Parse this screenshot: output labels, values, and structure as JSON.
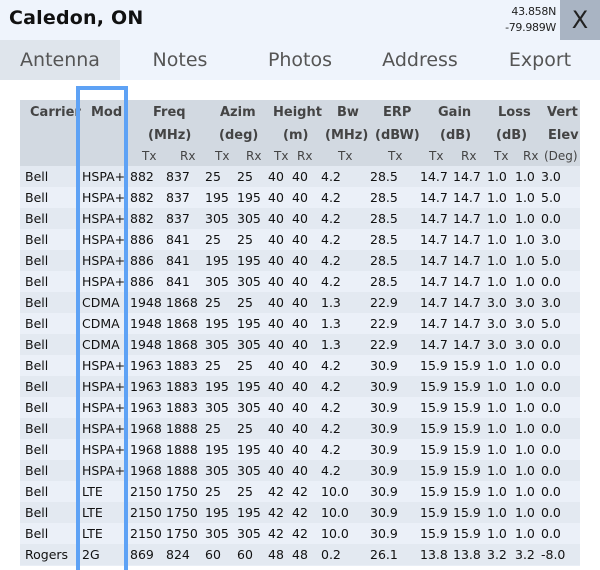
{
  "header": {
    "title": "Caledon, ON",
    "lat": "43.858N",
    "lon": "-79.989W",
    "close_label": "X"
  },
  "tabs": [
    {
      "label": "Antenna",
      "active": true
    },
    {
      "label": "Notes",
      "active": false
    },
    {
      "label": "Photos",
      "active": false
    },
    {
      "label": "Address",
      "active": false
    },
    {
      "label": "Export",
      "active": false
    }
  ],
  "table": {
    "headers": {
      "carrier": "Carrier",
      "mod": "Mod",
      "freq": "Freq",
      "freq_unit": "(MHz)",
      "azim": "Azim",
      "azim_unit": "(deg)",
      "height": "Height",
      "height_unit": "(m)",
      "bw": "Bw",
      "bw_unit": "(MHz)",
      "erp": "ERP",
      "erp_unit": "(dBW)",
      "gain": "Gain",
      "gain_unit": "(dB)",
      "loss": "Loss",
      "loss_unit": "(dB)",
      "vert": "Vert",
      "vert_unit": "Elev",
      "vert_sub": "(Deg)",
      "tx": "Tx",
      "rx": "Rx"
    },
    "highlighted_column": "Mod",
    "highlight_color": "#5ea2f5",
    "rows": [
      [
        "Bell",
        "HSPA+",
        "882",
        "837",
        "25",
        "25",
        "40",
        "40",
        "4.2",
        "28.5",
        "14.7",
        "14.7",
        "1.0",
        "1.0",
        "3.0"
      ],
      [
        "Bell",
        "HSPA+",
        "882",
        "837",
        "195",
        "195",
        "40",
        "40",
        "4.2",
        "28.5",
        "14.7",
        "14.7",
        "1.0",
        "1.0",
        "5.0"
      ],
      [
        "Bell",
        "HSPA+",
        "882",
        "837",
        "305",
        "305",
        "40",
        "40",
        "4.2",
        "28.5",
        "14.7",
        "14.7",
        "1.0",
        "1.0",
        "0.0"
      ],
      [
        "Bell",
        "HSPA+",
        "886",
        "841",
        "25",
        "25",
        "40",
        "40",
        "4.2",
        "28.5",
        "14.7",
        "14.7",
        "1.0",
        "1.0",
        "3.0"
      ],
      [
        "Bell",
        "HSPA+",
        "886",
        "841",
        "195",
        "195",
        "40",
        "40",
        "4.2",
        "28.5",
        "14.7",
        "14.7",
        "1.0",
        "1.0",
        "5.0"
      ],
      [
        "Bell",
        "HSPA+",
        "886",
        "841",
        "305",
        "305",
        "40",
        "40",
        "4.2",
        "28.5",
        "14.7",
        "14.7",
        "1.0",
        "1.0",
        "0.0"
      ],
      [
        "Bell",
        "CDMA",
        "1948",
        "1868",
        "25",
        "25",
        "40",
        "40",
        "1.3",
        "22.9",
        "14.7",
        "14.7",
        "3.0",
        "3.0",
        "3.0"
      ],
      [
        "Bell",
        "CDMA",
        "1948",
        "1868",
        "195",
        "195",
        "40",
        "40",
        "1.3",
        "22.9",
        "14.7",
        "14.7",
        "3.0",
        "3.0",
        "5.0"
      ],
      [
        "Bell",
        "CDMA",
        "1948",
        "1868",
        "305",
        "305",
        "40",
        "40",
        "1.3",
        "22.9",
        "14.7",
        "14.7",
        "3.0",
        "3.0",
        "0.0"
      ],
      [
        "Bell",
        "HSPA+",
        "1963",
        "1883",
        "25",
        "25",
        "40",
        "40",
        "4.2",
        "30.9",
        "15.9",
        "15.9",
        "1.0",
        "1.0",
        "0.0"
      ],
      [
        "Bell",
        "HSPA+",
        "1963",
        "1883",
        "195",
        "195",
        "40",
        "40",
        "4.2",
        "30.9",
        "15.9",
        "15.9",
        "1.0",
        "1.0",
        "0.0"
      ],
      [
        "Bell",
        "HSPA+",
        "1963",
        "1883",
        "305",
        "305",
        "40",
        "40",
        "4.2",
        "30.9",
        "15.9",
        "15.9",
        "1.0",
        "1.0",
        "0.0"
      ],
      [
        "Bell",
        "HSPA+",
        "1968",
        "1888",
        "25",
        "25",
        "40",
        "40",
        "4.2",
        "30.9",
        "15.9",
        "15.9",
        "1.0",
        "1.0",
        "0.0"
      ],
      [
        "Bell",
        "HSPA+",
        "1968",
        "1888",
        "195",
        "195",
        "40",
        "40",
        "4.2",
        "30.9",
        "15.9",
        "15.9",
        "1.0",
        "1.0",
        "0.0"
      ],
      [
        "Bell",
        "HSPA+",
        "1968",
        "1888",
        "305",
        "305",
        "40",
        "40",
        "4.2",
        "30.9",
        "15.9",
        "15.9",
        "1.0",
        "1.0",
        "0.0"
      ],
      [
        "Bell",
        "LTE",
        "2150",
        "1750",
        "25",
        "25",
        "42",
        "42",
        "10.0",
        "30.9",
        "15.9",
        "15.9",
        "1.0",
        "1.0",
        "0.0"
      ],
      [
        "Bell",
        "LTE",
        "2150",
        "1750",
        "195",
        "195",
        "42",
        "42",
        "10.0",
        "30.9",
        "15.9",
        "15.9",
        "1.0",
        "1.0",
        "0.0"
      ],
      [
        "Bell",
        "LTE",
        "2150",
        "1750",
        "305",
        "305",
        "42",
        "42",
        "10.0",
        "30.9",
        "15.9",
        "15.9",
        "1.0",
        "1.0",
        "0.0"
      ],
      [
        "Rogers",
        "2G",
        "869",
        "824",
        "60",
        "60",
        "48",
        "48",
        "0.2",
        "26.1",
        "13.8",
        "13.8",
        "3.2",
        "3.2",
        "-8.0"
      ]
    ]
  }
}
